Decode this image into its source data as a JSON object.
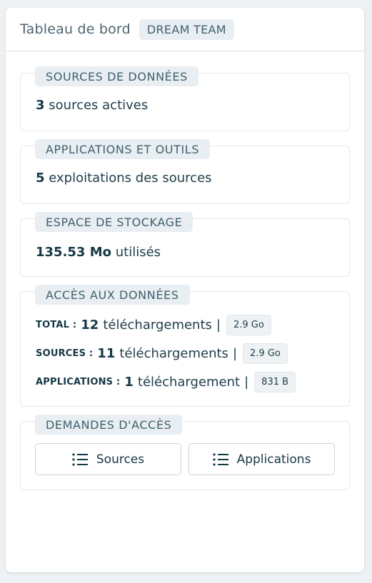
{
  "header": {
    "title": "Tableau de bord",
    "team": "DREAM TEAM"
  },
  "sources": {
    "label": "SOURCES DE DONNÉES",
    "count": "3",
    "text": "sources actives"
  },
  "applications": {
    "label": "APPLICATIONS ET OUTILS",
    "count": "5",
    "text": "exploitations des sources"
  },
  "storage": {
    "label": "ESPACE DE STOCKAGE",
    "value": "135.53 Mo",
    "text": "utilisés"
  },
  "access": {
    "label": "ACCÈS AUX DONNÉES",
    "rows": [
      {
        "key": "TOTAL :",
        "count": "12",
        "text": "téléchargements",
        "sep": "|",
        "size": "2.9 Go"
      },
      {
        "key": "SOURCES :",
        "count": "11",
        "text": "téléchargements",
        "sep": "|",
        "size": "2.9 Go"
      },
      {
        "key": "APPLICATIONS :",
        "count": "1",
        "text": "téléchargement",
        "sep": "|",
        "size": "831 B"
      }
    ]
  },
  "requests": {
    "label": "DEMANDES D'ACCÈS",
    "buttons": [
      {
        "label": "Sources",
        "icon": "list-icon"
      },
      {
        "label": "Applications",
        "icon": "list-icon"
      }
    ]
  }
}
